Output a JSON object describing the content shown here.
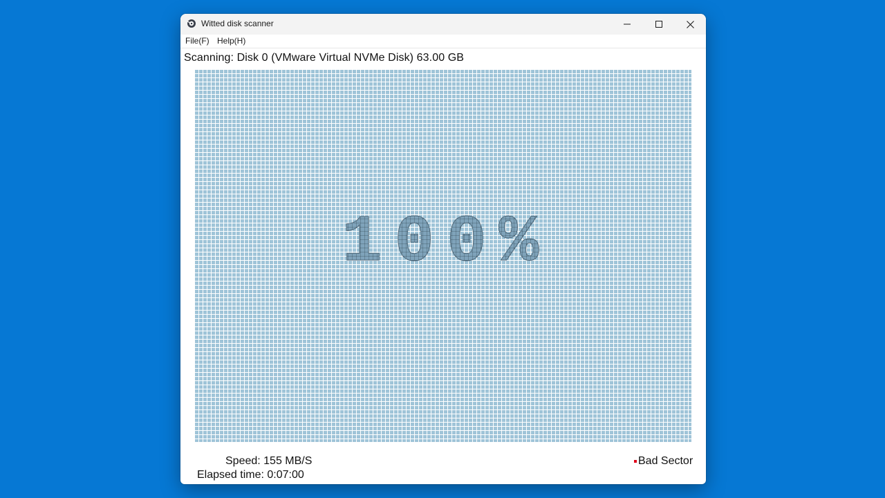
{
  "window": {
    "title": "Witted disk scanner",
    "icon": "disk-scanner-app-icon"
  },
  "menu": {
    "items": [
      {
        "label": "File(F)"
      },
      {
        "label": "Help(H)"
      }
    ]
  },
  "scan": {
    "status": "Scanning: Disk 0 (VMware Virtual NVMe Disk) 63.00 GB",
    "progress_label": "100%",
    "progress": 1.0
  },
  "footer": {
    "speed": "Speed: 155 MB/S",
    "elapsed": "Elapsed time: 0:07:00",
    "legend_label": "Bad Sector"
  },
  "colors": {
    "desktop": "#0678d4",
    "scanned_block": "#9fc4d8",
    "bad_sector": "#e0001a"
  }
}
